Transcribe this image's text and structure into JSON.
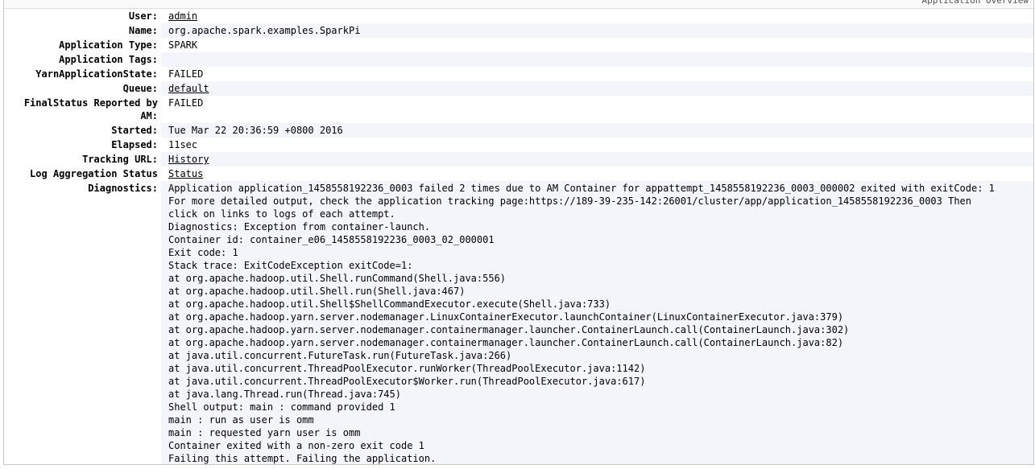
{
  "panel": {
    "title": "Application Overview"
  },
  "overview": {
    "user_label": "User:",
    "user_value": "admin",
    "name_label": "Name:",
    "name_value": "org.apache.spark.examples.SparkPi",
    "type_label": "Application Type:",
    "type_value": "SPARK",
    "tags_label": "Application Tags:",
    "tags_value": "",
    "state_label": "YarnApplicationState:",
    "state_value": "FAILED",
    "queue_label": "Queue:",
    "queue_value": "default",
    "final_status_label": "FinalStatus Reported by AM:",
    "final_status_value": "FAILED",
    "started_label": "Started:",
    "started_value": "Tue Mar 22 20:36:59 +0800 2016",
    "elapsed_label": "Elapsed:",
    "elapsed_value": "11sec",
    "tracking_url_label": "Tracking URL:",
    "tracking_url_value": "History",
    "log_aggregation_label": "Log Aggregation Status",
    "log_aggregation_value": "Status",
    "diagnostics_label": "Diagnostics:"
  },
  "diagnostics": {
    "lines": [
      "Application application_1458558192236_0003 failed 2 times due to AM Container for appattempt_1458558192236_0003_000002 exited with exitCode: 1",
      "For more detailed output, check the application tracking page:https://189-39-235-142:26001/cluster/app/application_1458558192236_0003 Then click on links to logs of each attempt.",
      "Diagnostics: Exception from container-launch.",
      "Container id: container_e06_1458558192236_0003_02_000001",
      "Exit code: 1",
      "Stack trace: ExitCodeException exitCode=1:",
      "at org.apache.hadoop.util.Shell.runCommand(Shell.java:556)",
      "at org.apache.hadoop.util.Shell.run(Shell.java:467)",
      "at org.apache.hadoop.util.Shell$ShellCommandExecutor.execute(Shell.java:733)",
      "at org.apache.hadoop.yarn.server.nodemanager.LinuxContainerExecutor.launchContainer(LinuxContainerExecutor.java:379)",
      "at org.apache.hadoop.yarn.server.nodemanager.containermanager.launcher.ContainerLaunch.call(ContainerLaunch.java:302)",
      "at org.apache.hadoop.yarn.server.nodemanager.containermanager.launcher.ContainerLaunch.call(ContainerLaunch.java:82)",
      "at java.util.concurrent.FutureTask.run(FutureTask.java:266)",
      "at java.util.concurrent.ThreadPoolExecutor.runWorker(ThreadPoolExecutor.java:1142)",
      "at java.util.concurrent.ThreadPoolExecutor$Worker.run(ThreadPoolExecutor.java:617)",
      "at java.lang.Thread.run(Thread.java:745)",
      "Shell output: main : command provided 1",
      "main : run as user is omm",
      "main : requested yarn user is omm",
      "Container exited with a non-zero exit code 1",
      "Failing this attempt. Failing the application."
    ]
  }
}
